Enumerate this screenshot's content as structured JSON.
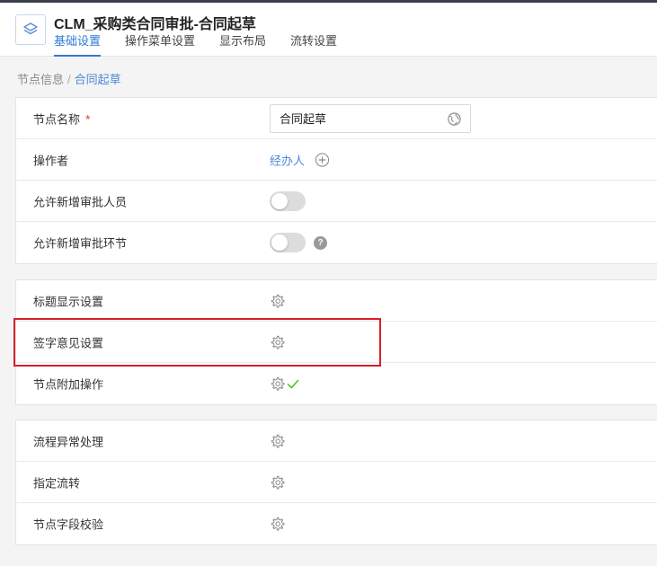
{
  "app": {
    "title": "CLM_采购类合同审批-合同起草",
    "logo_icon": "layers-icon"
  },
  "tabs": [
    {
      "label": "基础设置",
      "active": true
    },
    {
      "label": "操作菜单设置",
      "active": false
    },
    {
      "label": "显示布局",
      "active": false
    },
    {
      "label": "流转设置",
      "active": false
    }
  ],
  "breadcrumb": {
    "parent": "节点信息",
    "separator": "/",
    "current": "合同起草"
  },
  "basic": {
    "node_name_label": "节点名称",
    "required_mark": "*",
    "node_name_value": "合同起草",
    "operator_label": "操作者",
    "operator_value": "经办人",
    "allow_add_approver_label": "允许新增审批人员",
    "allow_add_approver_on": false,
    "allow_add_step_label": "允许新增审批环节",
    "allow_add_step_on": false,
    "help_glyph": "?"
  },
  "display": {
    "title_display_label": "标题显示设置",
    "signature_opinion_label": "签字意见设置",
    "node_extra_ops_label": "节点附加操作",
    "node_extra_ops_configured": true
  },
  "flow": {
    "exception_label": "流程异常处理",
    "specified_flow_label": "指定流转",
    "field_validation_label": "节点字段校验"
  },
  "colors": {
    "accent": "#2f7ad8",
    "link": "#4a8ad8",
    "required": "#e0452f",
    "highlight_box": "#d8202a",
    "check": "#52c41a"
  }
}
